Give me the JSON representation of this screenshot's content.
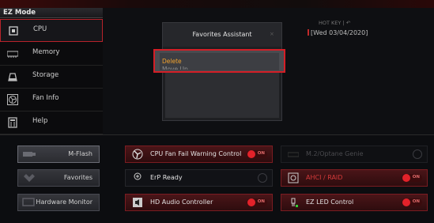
{
  "mode": {
    "label": "EZ Mode"
  },
  "sidebar": {
    "items": [
      {
        "label": "CPU",
        "icon": "cpu-icon",
        "active": true
      },
      {
        "label": "Memory",
        "icon": "memory-icon"
      },
      {
        "label": "Storage",
        "icon": "storage-icon"
      },
      {
        "label": "Fan Info",
        "icon": "fan-icon"
      },
      {
        "label": "Help",
        "icon": "help-icon"
      }
    ]
  },
  "header": {
    "hotkey": "HOT KEY  |  ↶",
    "date": "[Wed  03/04/2020]"
  },
  "dialog": {
    "title": "Favorites Assistant",
    "close": "×",
    "menu": {
      "option1": "Delete",
      "option2": "Move Up"
    }
  },
  "bottom_left": [
    {
      "label": "M-Flash",
      "icon": "usb-flash-icon"
    },
    {
      "label": "Favorites",
      "icon": "favorites-icon"
    },
    {
      "label": "Hardware Monitor",
      "icon": "monitor-icon"
    }
  ],
  "features": [
    {
      "label": "CPU Fan Fail Warning Control",
      "icon": "fan-warning-icon",
      "state": "on",
      "toggle_text": "ON"
    },
    {
      "label": "M.2/Optane Genie",
      "icon": "m2-icon",
      "state": "disabled"
    },
    {
      "label": "ErP Ready",
      "icon": "erp-icon",
      "state": "off"
    },
    {
      "label": "AHCI / RAID",
      "icon": "raid-icon",
      "state": "on",
      "toggle_text": "ON",
      "warn": true
    },
    {
      "label": "HD Audio Controller",
      "icon": "audio-icon",
      "state": "on",
      "toggle_text": "ON"
    },
    {
      "label": "EZ LED Control",
      "icon": "led-icon",
      "state": "on",
      "toggle_text": "ON"
    }
  ],
  "colors": {
    "accent": "#d41e26",
    "highlight": "#f2a32e"
  }
}
